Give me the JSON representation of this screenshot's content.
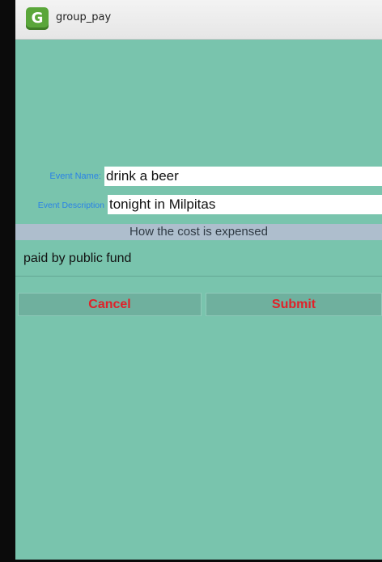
{
  "app": {
    "title": "group_pay",
    "icon": "app-logo-g-icon",
    "icon_letter": "G",
    "icon_color": "#5aa63a"
  },
  "form": {
    "event_name": {
      "label": "Event Name:",
      "value": "drink a beer"
    },
    "event_description": {
      "label": "Event Description",
      "value": "tonight in Milpitas"
    },
    "expense_section": {
      "header": "How the cost is expensed",
      "selected_option": "paid by public fund"
    }
  },
  "buttons": {
    "cancel_label": "Cancel",
    "submit_label": "Submit"
  },
  "colors": {
    "background": "#79c4ad",
    "label_text": "#2a82e6",
    "button_text": "#e0222a",
    "section_header_bg": "#aebecd"
  }
}
